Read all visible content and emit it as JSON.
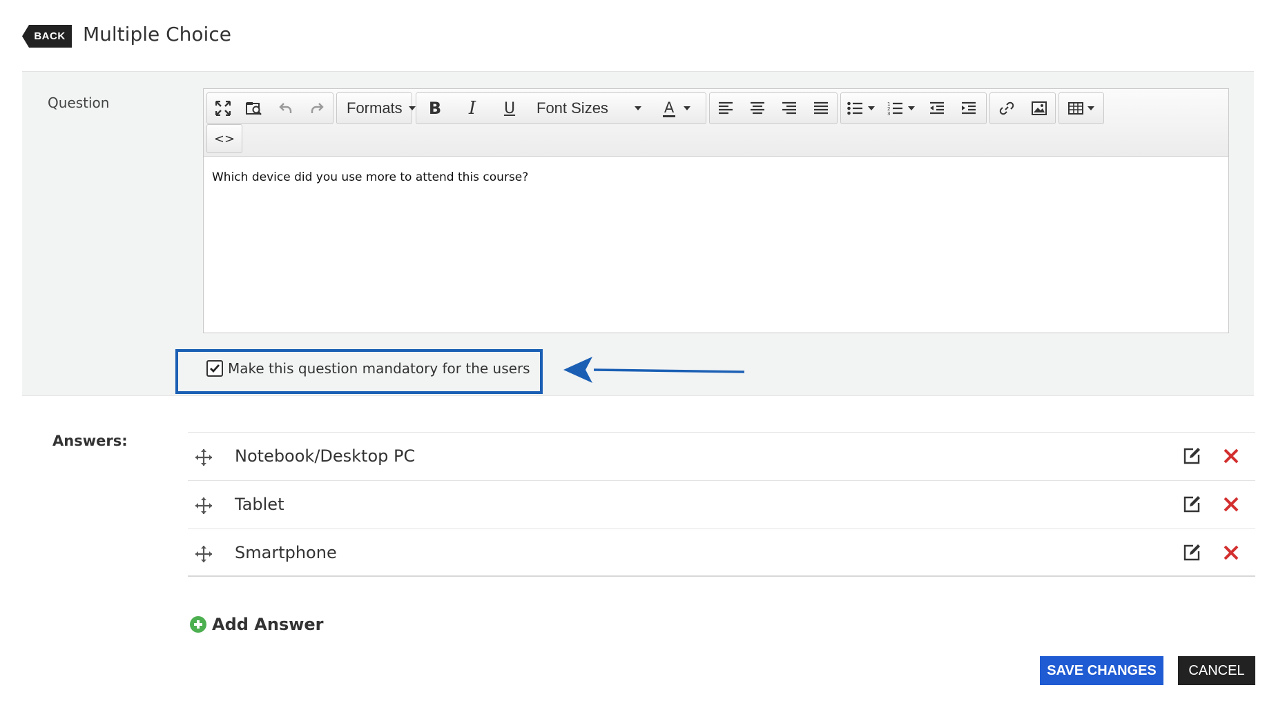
{
  "header": {
    "back_label": "BACK",
    "title": "Multiple Choice"
  },
  "question": {
    "label": "Question",
    "content": "Which device did you use more to attend this course?"
  },
  "toolbar": {
    "formats_label": "Formats",
    "font_sizes_label": "Font Sizes",
    "text_color_label": "A",
    "bold_label": "B",
    "italic_label": "I",
    "underline_label": "U",
    "code_label": "<>"
  },
  "mandatory": {
    "label": "Make this question mandatory for the users",
    "checked": true
  },
  "answers": {
    "label": "Answers:",
    "items": [
      {
        "text": "Notebook/Desktop PC"
      },
      {
        "text": "Tablet"
      },
      {
        "text": "Smartphone"
      }
    ],
    "add_label": "Add Answer"
  },
  "actions": {
    "save_label": "SAVE CHANGES",
    "cancel_label": "CANCEL"
  },
  "colors": {
    "accent_blue": "#1f5bd3",
    "highlight_border": "#1a5fb4",
    "delete_red": "#d32f2f",
    "add_green": "#4caf50"
  }
}
